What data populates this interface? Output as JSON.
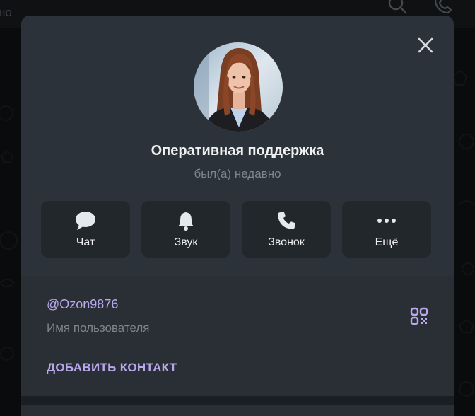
{
  "background": {
    "header_text": "но"
  },
  "profile": {
    "name": "Оперативная поддержка",
    "status": "был(а) недавно"
  },
  "actions": [
    {
      "label": "Чат",
      "icon": "chat-bubble-icon"
    },
    {
      "label": "Звук",
      "icon": "bell-icon"
    },
    {
      "label": "Звонок",
      "icon": "phone-icon"
    },
    {
      "label": "Ещё",
      "icon": "more-dots-icon"
    }
  ],
  "info": {
    "username": "@Ozon9876",
    "username_caption": "Имя пользователя",
    "add_contact_label": "ДОБАВИТЬ КОНТАКТ"
  },
  "colors": {
    "accent": "#b9a8ec",
    "modal_bg": "#2c3239",
    "action_bg": "#22272c"
  }
}
